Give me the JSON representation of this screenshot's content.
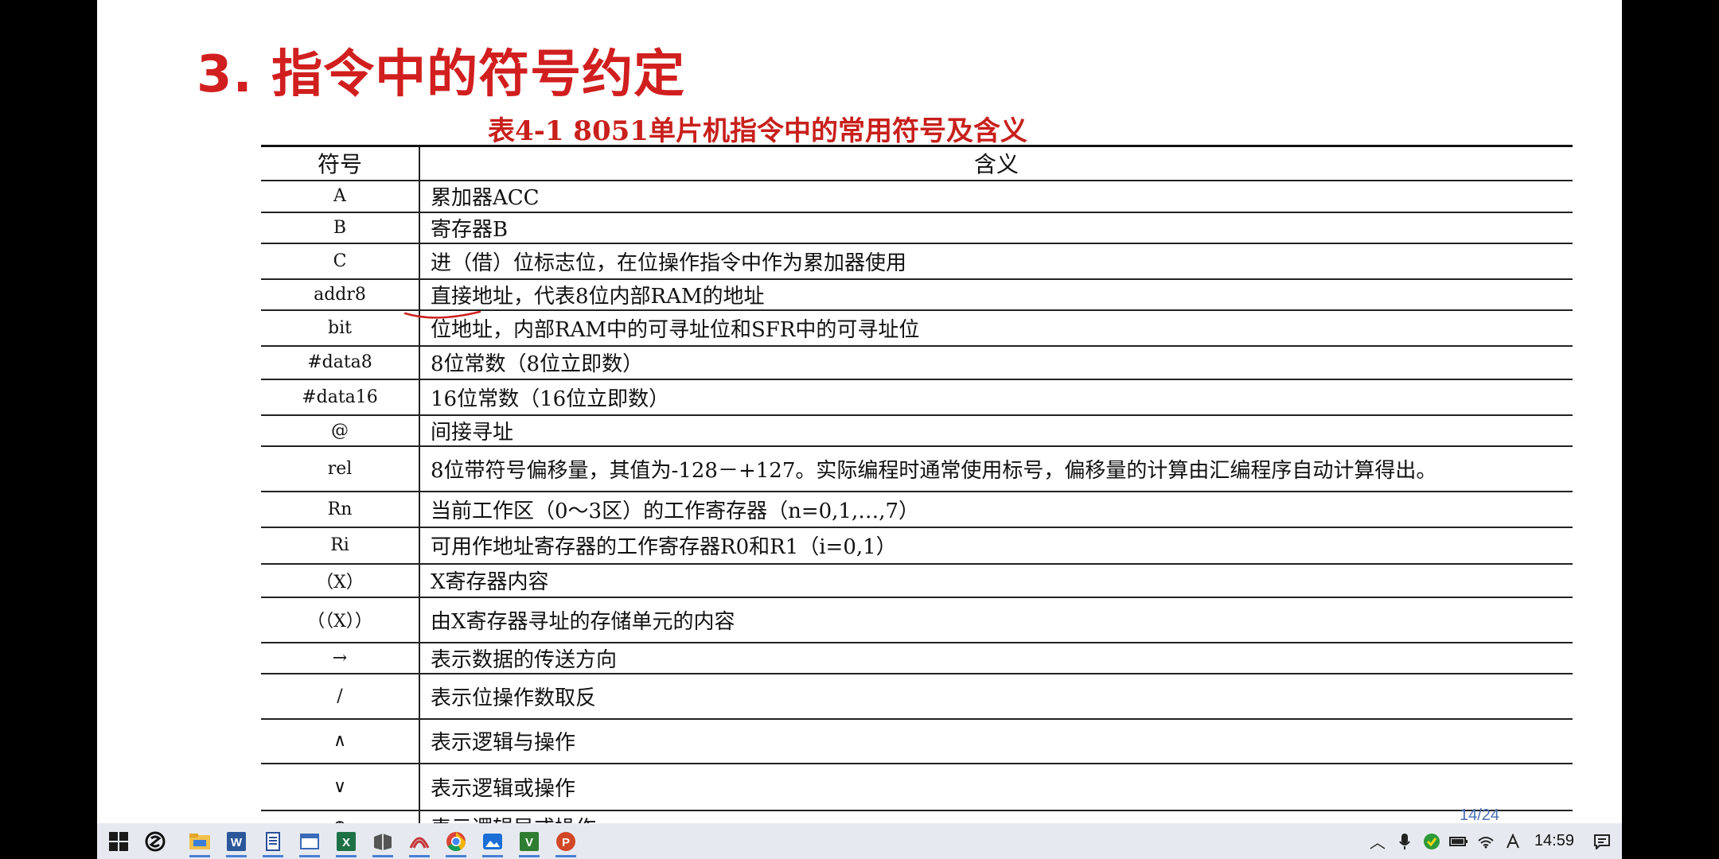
{
  "slide": {
    "title": "3. 指令中的符号约定",
    "table_caption": "表4-1  8051单片机指令中的常用符号及含义",
    "headers": [
      "符号",
      "含义"
    ],
    "rows": [
      {
        "symbol": "A",
        "meaning": "累加器ACC"
      },
      {
        "symbol": "B",
        "meaning": "寄存器B"
      },
      {
        "symbol": "C",
        "meaning": "进（借）位标志位，在位操作指令中作为累加器使用"
      },
      {
        "symbol": "addr8",
        "meaning": "直接地址，代表8位内部RAM的地址"
      },
      {
        "symbol": "bit",
        "meaning": "位地址，内部RAM中的可寻址位和SFR中的可寻址位"
      },
      {
        "symbol": "#data8",
        "meaning": "8位常数（8位立即数）"
      },
      {
        "symbol": "#data16",
        "meaning": "16位常数（16位立即数）"
      },
      {
        "symbol": "@",
        "meaning": "间接寻址"
      },
      {
        "symbol": "rel",
        "meaning": "8位带符号偏移量，其值为-128－+127。实际编程时通常使用标号，偏移量的计算由汇编程序自动计算得出。"
      },
      {
        "symbol": "Rn",
        "meaning": "当前工作区（0～3区）的工作寄存器（n=0,1,…,7）"
      },
      {
        "symbol": "Ri",
        "meaning": "可用作地址寄存器的工作寄存器R0和R1（i=0,1）"
      },
      {
        "symbol": "（X）",
        "meaning": "X寄存器内容"
      },
      {
        "symbol": "（（X））",
        "meaning": "由X寄存器寻址的存储单元的内容"
      },
      {
        "symbol": "→",
        "meaning": "表示数据的传送方向"
      },
      {
        "symbol": "/",
        "meaning": "表示位操作数取反"
      },
      {
        "symbol": "∧",
        "meaning": "表示逻辑与操作"
      },
      {
        "symbol": "∨",
        "meaning": "表示逻辑或操作"
      },
      {
        "symbol": "⊕",
        "meaning": "表示逻辑异或操作"
      }
    ],
    "page_number": "14/24"
  },
  "taskbar": {
    "apps": [
      "start-icon",
      "app-s-icon",
      "file-explorer-icon",
      "word-icon",
      "app-doc-icon",
      "app-window-icon",
      "excel-icon",
      "app-book-icon",
      "app-reader-icon",
      "chrome-icon",
      "app-photo-icon",
      "app-v-icon",
      "powerpoint-icon"
    ],
    "clock": "14:59"
  },
  "colors": {
    "title": "#d11f1f",
    "caption": "#c8201c",
    "annotation": "#cc2222",
    "taskbar": "#e6eaf0"
  }
}
